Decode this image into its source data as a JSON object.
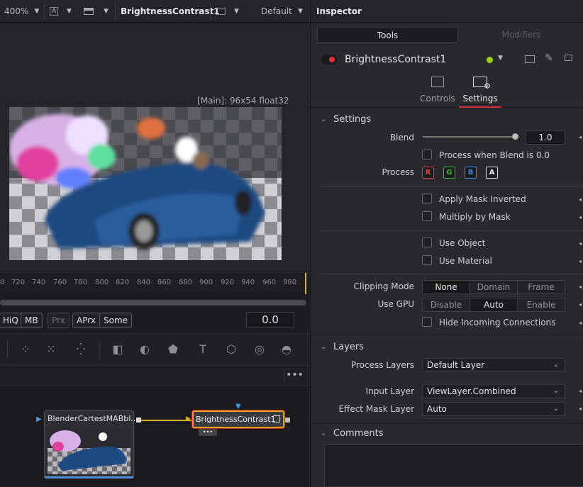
{
  "viewer": {
    "zoom": "400%",
    "node_name": "BrightnessContrast1",
    "layout_preset": "Default",
    "image_label": "[Main]: 96x54 float32",
    "ruler_ticks": [
      "0",
      "720",
      "740",
      "760",
      "780",
      "800",
      "820",
      "840",
      "860",
      "880",
      "900",
      "920",
      "940",
      "960",
      "980"
    ],
    "toggles": [
      "HiQ",
      "MB",
      "Prx",
      "APrx",
      "Some"
    ],
    "time_value": "0.0"
  },
  "nodes": {
    "source_node": "BlenderCartestMABbl...",
    "effect_node": "BrightnessContrast1"
  },
  "inspector": {
    "title": "Inspector",
    "tabs": [
      "Tools",
      "Modifiers"
    ],
    "tool_name": "BrightnessContrast1",
    "sub_tabs": [
      "Controls",
      "Settings"
    ],
    "settings": {
      "section": "Settings",
      "blend_label": "Blend",
      "blend_value": "1.0",
      "blend_fraction": 1.0,
      "process_when_blend": "Process when Blend is 0.0",
      "process_label": "Process",
      "channels": [
        "R",
        "G",
        "B",
        "A"
      ],
      "apply_mask_inverted": "Apply Mask Inverted",
      "multiply_by_mask": "Multiply by Mask",
      "use_object": "Use Object",
      "use_material": "Use Material",
      "clipping_mode_label": "Clipping Mode",
      "clipping_modes": [
        "None",
        "Domain",
        "Frame"
      ],
      "use_gpu_label": "Use GPU",
      "gpu_modes": [
        "Disable",
        "Auto",
        "Enable"
      ],
      "hide_incoming": "Hide Incoming Connections"
    },
    "layers": {
      "section": "Layers",
      "process_layers_label": "Process Layers",
      "process_layers_value": "Default Layer",
      "input_layer_label": "Input Layer",
      "input_layer_value": "ViewLayer.Combined",
      "effect_mask_label": "Effect Mask Layer",
      "effect_mask_value": "Auto"
    },
    "comments": {
      "section": "Comments"
    }
  },
  "colors": {
    "accent_red": "#d03030",
    "channel_r": "#e04040",
    "channel_g": "#30c030",
    "channel_b": "#3a8ae0",
    "channel_a": "#e0e0e0",
    "node_selected": "#e0a020"
  }
}
